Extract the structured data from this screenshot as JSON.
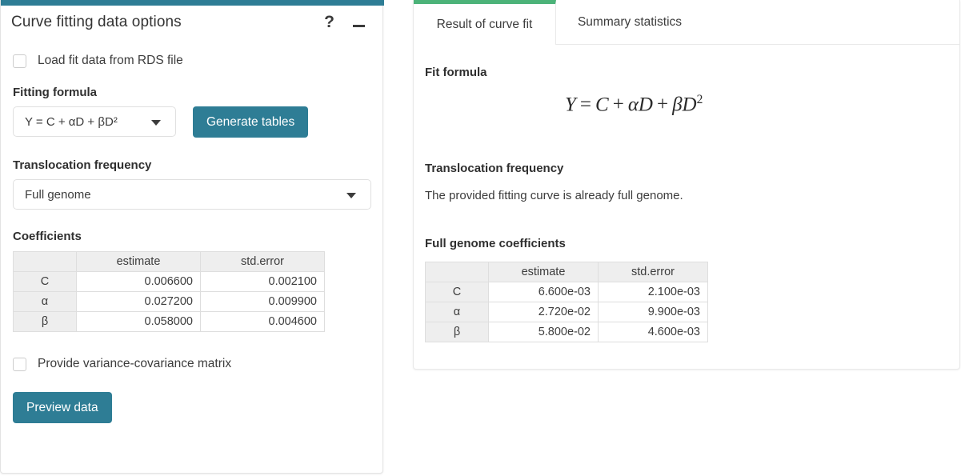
{
  "theme": {
    "panel_accent": "#2e7d95",
    "tab_accent": "#4cb379",
    "button_bg": "#2e7d95",
    "table_header_bg": "#eeeeee",
    "border": "#e3e3e3"
  },
  "left_panel": {
    "title": "Curve fitting data options",
    "help_icon": "?",
    "minimize_icon": "–",
    "load_checkbox": {
      "label": "Load fit data from RDS file",
      "checked": false
    },
    "fitting_formula": {
      "label": "Fitting formula",
      "selected": "Y = C + αD + βD²"
    },
    "generate_button": "Generate tables",
    "translocation": {
      "label": "Translocation frequency",
      "selected": "Full genome"
    },
    "coefficients": {
      "label": "Coefficients",
      "columns": [
        "",
        "estimate",
        "std.error"
      ],
      "rows": [
        {
          "name": "C",
          "estimate": "0.006600",
          "std_error": "0.002100"
        },
        {
          "name": "α",
          "estimate": "0.027200",
          "std_error": "0.009900"
        },
        {
          "name": "β",
          "estimate": "0.058000",
          "std_error": "0.004600"
        }
      ]
    },
    "varcov_checkbox": {
      "label": "Provide variance-covariance matrix",
      "checked": false
    },
    "preview_button": "Preview data"
  },
  "right_panel": {
    "tabs": [
      {
        "label": "Result of curve fit",
        "active": true
      },
      {
        "label": "Summary statistics",
        "active": false
      }
    ],
    "fit_formula": {
      "heading": "Fit formula",
      "expression": "Y = C + αD + βD²"
    },
    "translocation": {
      "heading": "Translocation frequency",
      "text": "The provided fitting curve is already full genome."
    },
    "full_genome_coefficients": {
      "heading": "Full genome coefficients",
      "columns": [
        "",
        "estimate",
        "std.error"
      ],
      "rows": [
        {
          "name": "C",
          "estimate": "6.600e-03",
          "std_error": "2.100e-03"
        },
        {
          "name": "α",
          "estimate": "2.720e-02",
          "std_error": "9.900e-03"
        },
        {
          "name": "β",
          "estimate": "5.800e-02",
          "std_error": "4.600e-03"
        }
      ]
    }
  }
}
